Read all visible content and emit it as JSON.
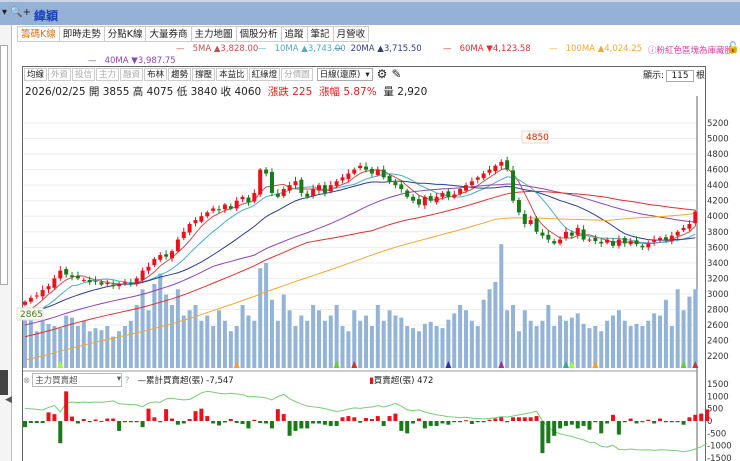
{
  "window": {
    "title": "緯穎",
    "controls": "▾ 🔍+"
  },
  "tabs": [
    "籌碼K線",
    "即時走勢",
    "分點K線",
    "大量券商",
    "主力地圖",
    "個股分析",
    "追蹤",
    "筆記",
    "月營收"
  ],
  "ma_legend": [
    {
      "label": "5MA",
      "dir": "▲",
      "value": "3,828.00",
      "color": "#c0504d"
    },
    {
      "label": "10MA",
      "dir": "▲",
      "value": "3,743.00",
      "color": "#4bacc6"
    },
    {
      "label": "20MA",
      "dir": "▲",
      "value": "3,715.50",
      "color": "#2c3e8c"
    },
    {
      "label": "60MA",
      "dir": "▼",
      "value": "4,123.58",
      "color": "#e03030"
    },
    {
      "label": "100MA",
      "dir": "▲",
      "value": "4,024.25",
      "color": "#f0a830"
    },
    {
      "label": "40MA",
      "dir": "▼",
      "value": "3,987.75",
      "color": "#8e44ad"
    }
  ],
  "notice": "ⓘ粉紅色區塊為庫藏股",
  "toolbar": {
    "buttons": [
      {
        "label": "均線",
        "enabled": true
      },
      {
        "label": "外資",
        "enabled": false
      },
      {
        "label": "投信",
        "enabled": false
      },
      {
        "label": "主力",
        "enabled": false
      },
      {
        "label": "融資",
        "enabled": false
      },
      {
        "label": "布林",
        "enabled": true
      },
      {
        "label": "趨勢",
        "enabled": true
      },
      {
        "label": "撐壓",
        "enabled": true
      },
      {
        "label": "本益比",
        "enabled": true
      },
      {
        "label": "紅綠燈",
        "enabled": true
      },
      {
        "label": "分價圖",
        "enabled": false
      }
    ],
    "period": "日線(還原)"
  },
  "display": {
    "label": "顯示:",
    "count": "115",
    "unit": "根"
  },
  "info": {
    "date": "2026/02/25",
    "open_label": "開",
    "open": "3855",
    "high_label": "高",
    "high": "4075",
    "low_label": "低",
    "low": "3840",
    "close_label": "收",
    "close": "4060",
    "chg_label": "漲跌",
    "chg": "225",
    "pct_label": "漲幅",
    "pct": "5.87%",
    "vol_label": "量",
    "vol": "2,920"
  },
  "price_axis": [
    "5200",
    "5000",
    "4800",
    "4600",
    "4400",
    "4200",
    "4000",
    "3800",
    "3600",
    "3400",
    "3200",
    "3000",
    "2800",
    "2600",
    "2400",
    "2200"
  ],
  "annotations": {
    "max": "4850",
    "min": "2865"
  },
  "lower": {
    "indicator": "主力買賣超",
    "cum_label": "累計買賣超(張)",
    "cum_value": "-7,547",
    "net_label": "買賣超(張)",
    "net_value": "472",
    "axis": [
      "1500",
      "1000",
      "500",
      "0",
      "-500",
      "-1000",
      "-1500"
    ]
  },
  "colors": {
    "up": "#e8121a",
    "down": "#1a7a1a",
    "volume": "#93b4d6"
  },
  "chart_data": {
    "type": "candlestick",
    "closes": [
      2900,
      2950,
      2980,
      3050,
      3100,
      3200,
      3300,
      3250,
      3220,
      3200,
      3180,
      3150,
      3160,
      3120,
      3140,
      3100,
      3130,
      3150,
      3120,
      3200,
      3300,
      3350,
      3450,
      3500,
      3480,
      3550,
      3700,
      3800,
      3900,
      3950,
      4000,
      4050,
      4100,
      4080,
      4150,
      4100,
      4200,
      4250,
      4180,
      4300,
      4600,
      4550,
      4300,
      4250,
      4350,
      4400,
      4450,
      4300,
      4250,
      4350,
      4400,
      4300,
      4400,
      4450,
      4500,
      4550,
      4600,
      4650,
      4600,
      4550,
      4600,
      4500,
      4450,
      4400,
      4350,
      4250,
      4200,
      4150,
      4250,
      4200,
      4250,
      4300,
      4250,
      4280,
      4350,
      4400,
      4450,
      4500,
      4550,
      4600,
      4650,
      4700,
      4600,
      4200,
      4050,
      3900,
      3950,
      3800,
      3750,
      3700,
      3650,
      3700,
      3800,
      3750,
      3850,
      3700,
      3700,
      3680,
      3650,
      3700,
      3620,
      3700,
      3650,
      3680,
      3640,
      3600,
      3650,
      3700,
      3720,
      3700,
      3750,
      3800,
      3850,
      3900,
      4060
    ],
    "volumes": [
      55,
      50,
      35,
      45,
      42,
      40,
      38,
      50,
      48,
      40,
      45,
      35,
      38,
      36,
      40,
      30,
      35,
      40,
      45,
      60,
      75,
      55,
      80,
      90,
      70,
      60,
      75,
      50,
      55,
      60,
      45,
      50,
      40,
      55,
      45,
      35,
      40,
      60,
      50,
      45,
      95,
      100,
      65,
      45,
      70,
      55,
      40,
      50,
      45,
      60,
      55,
      45,
      50,
      60,
      40,
      35,
      55,
      45,
      50,
      40,
      60,
      45,
      55,
      50,
      48,
      40,
      38,
      35,
      42,
      44,
      40,
      38,
      46,
      52,
      60,
      55,
      45,
      40,
      65,
      75,
      82,
      118,
      55,
      60,
      35,
      55,
      45,
      40,
      45,
      60,
      40,
      50,
      45,
      48,
      52,
      42,
      38,
      40,
      35,
      45,
      50,
      55,
      45,
      40,
      42,
      40,
      45,
      52,
      50,
      65,
      40,
      75,
      55,
      68,
      75
    ],
    "netflow": [
      -250,
      -80,
      -80,
      -80,
      350,
      280,
      -900,
      1200,
      180,
      -100,
      80,
      -50,
      60,
      -40,
      100,
      100,
      -400,
      -50,
      -50,
      -50,
      -250,
      500,
      150,
      -50,
      480,
      100,
      -150,
      -100,
      80,
      400,
      500,
      200,
      -100,
      -180,
      -60,
      80,
      -80,
      -120,
      -300,
      50,
      -80,
      -100,
      -300,
      480,
      280,
      -600,
      -400,
      -300,
      -300,
      -100,
      -100,
      -150,
      -200,
      -200,
      150,
      200,
      150,
      -70,
      120,
      80,
      200,
      -200,
      200,
      300,
      -400,
      -500,
      -100,
      100,
      -300,
      -200,
      -200,
      -100,
      -150,
      -50,
      -50,
      30,
      -120,
      -50,
      -50,
      50,
      100,
      150,
      -50,
      150,
      150,
      150,
      150,
      200,
      -1300,
      -900,
      -600,
      -300,
      -200,
      -150,
      -300,
      -200,
      -350,
      -50,
      -500,
      -100,
      250,
      -550,
      -50,
      100,
      -100,
      -50,
      50,
      -100,
      100,
      -50,
      -50,
      -50,
      -150,
      150,
      250,
      300,
      472
    ]
  }
}
